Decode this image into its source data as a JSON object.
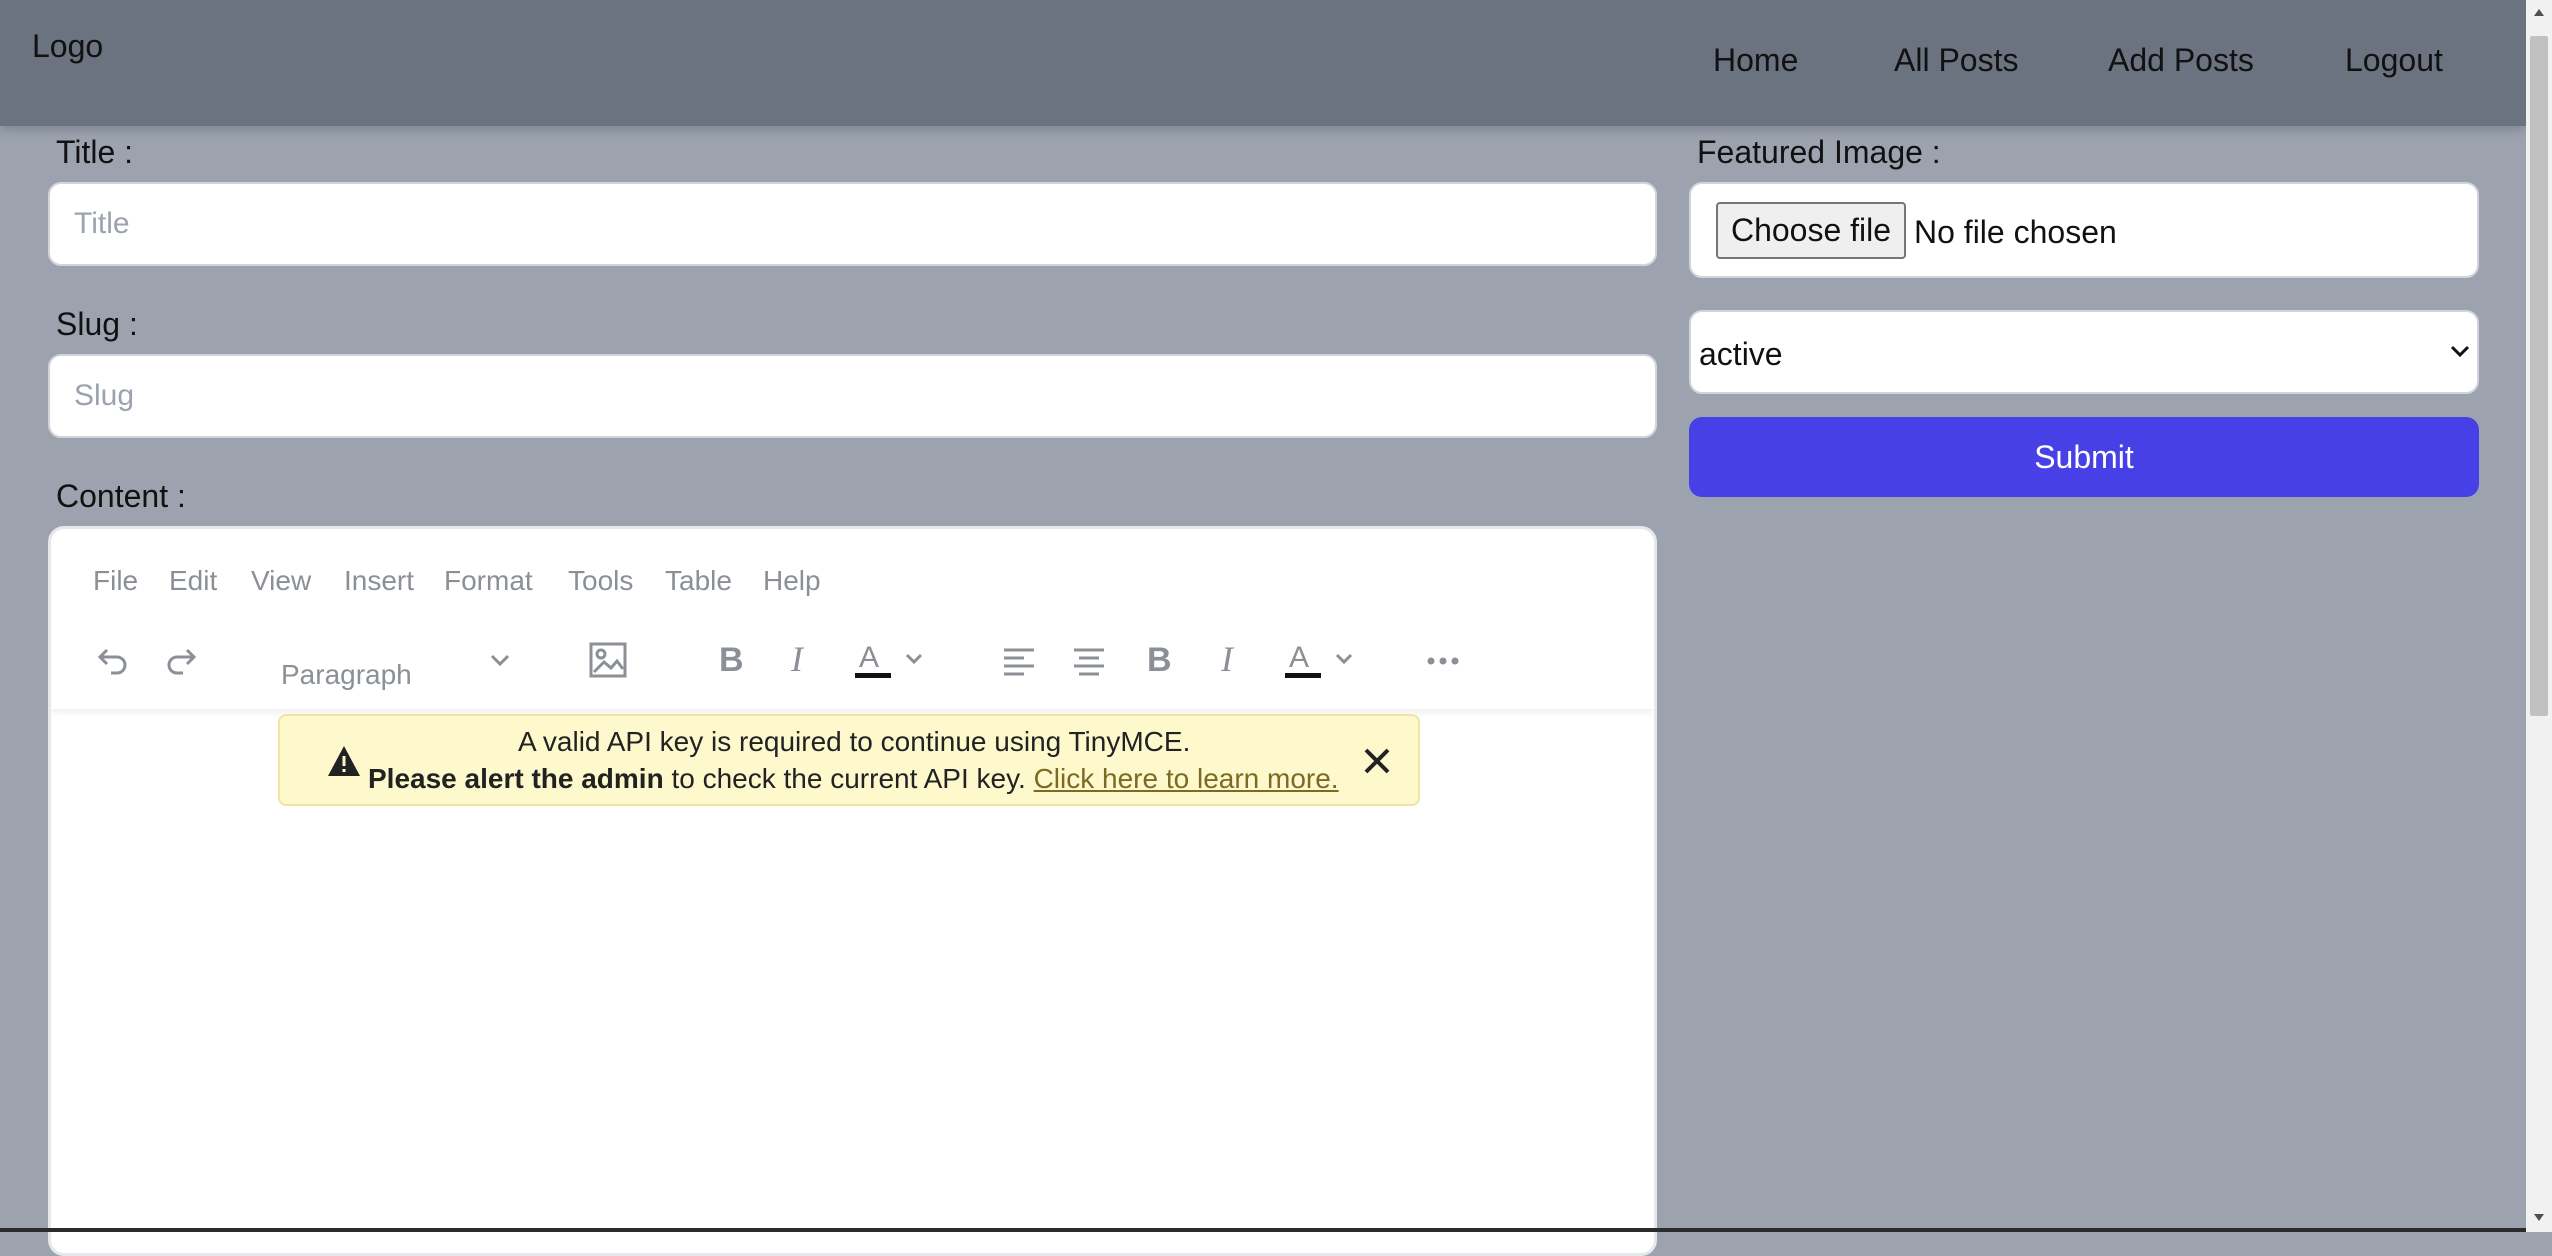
{
  "header": {
    "logo": "Logo",
    "nav": [
      "Home",
      "All Posts",
      "Add Posts",
      "Logout"
    ]
  },
  "form": {
    "title_label": "Title :",
    "title_placeholder": "Title",
    "slug_label": "Slug :",
    "slug_placeholder": "Slug",
    "content_label": "Content :",
    "featured_label": "Featured Image :",
    "file_button": "Choose file",
    "file_status": "No file chosen",
    "status_value": "active",
    "submit_label": "Submit"
  },
  "editor": {
    "menu": [
      "File",
      "Edit",
      "View",
      "Insert",
      "Format",
      "Tools",
      "Table",
      "Help"
    ],
    "block_format": "Paragraph",
    "toolbar_icons": [
      "undo-icon",
      "redo-icon",
      "image-icon",
      "bold-icon",
      "italic-icon",
      "text-color-icon",
      "align-left-icon",
      "align-center-icon",
      "more-icon"
    ],
    "notice_line1": "A valid API key is required to continue using TinyMCE.",
    "notice_bold": "Please alert the admin",
    "notice_mid": " to check the current API key. ",
    "notice_link": "Click here to learn more."
  },
  "colors": {
    "page_bg": "#9ca3af",
    "header_bg": "#6b7280",
    "submit_bg": "#4640e6",
    "notice_bg": "#fdf9cd"
  }
}
